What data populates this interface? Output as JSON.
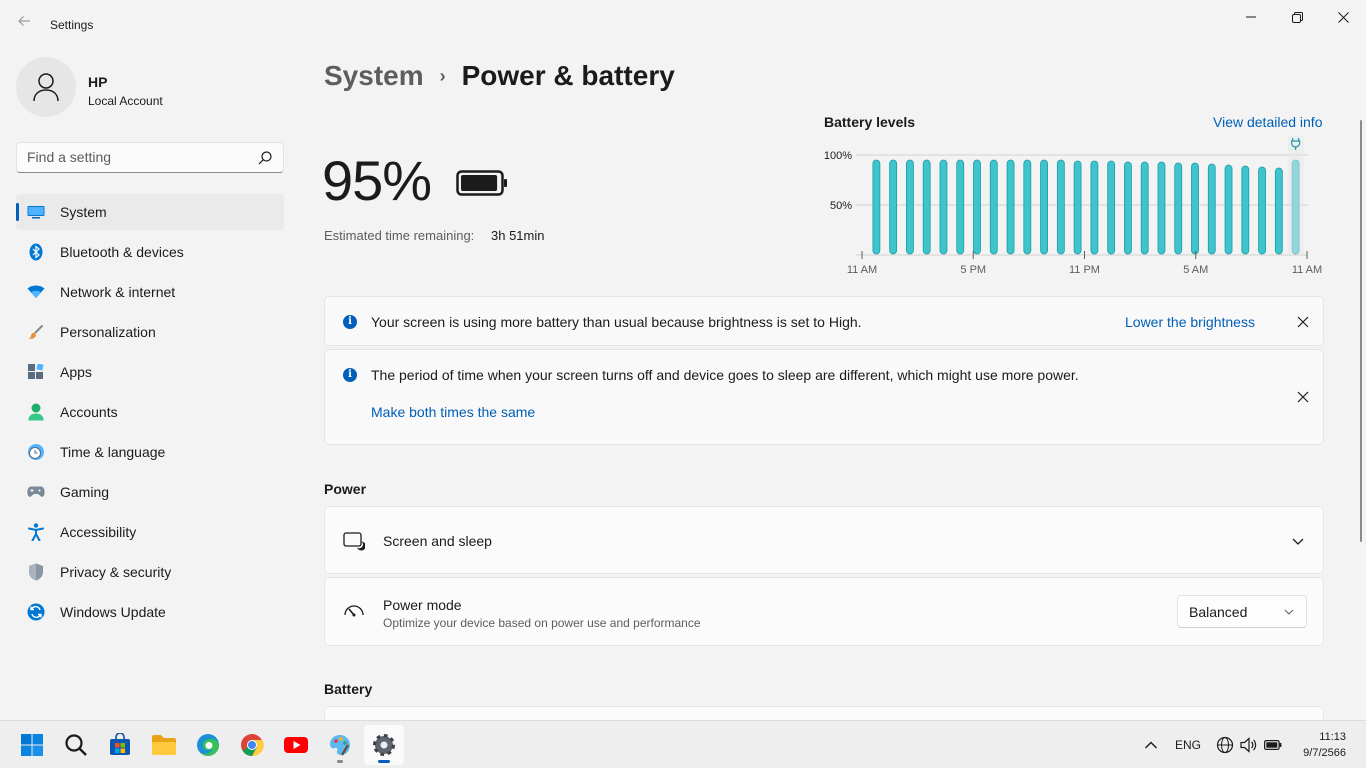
{
  "window": {
    "title": "Settings"
  },
  "profile": {
    "name": "HP",
    "account_type": "Local Account"
  },
  "search": {
    "placeholder": "Find a setting"
  },
  "nav": [
    {
      "label": "System",
      "icon": "monitor-icon",
      "active": true
    },
    {
      "label": "Bluetooth & devices",
      "icon": "bluetooth-icon"
    },
    {
      "label": "Network & internet",
      "icon": "wifi-icon"
    },
    {
      "label": "Personalization",
      "icon": "brush-icon"
    },
    {
      "label": "Apps",
      "icon": "apps-icon"
    },
    {
      "label": "Accounts",
      "icon": "person-icon"
    },
    {
      "label": "Time & language",
      "icon": "clock-globe-icon"
    },
    {
      "label": "Gaming",
      "icon": "gamepad-icon"
    },
    {
      "label": "Accessibility",
      "icon": "accessibility-icon"
    },
    {
      "label": "Privacy & security",
      "icon": "shield-icon"
    },
    {
      "label": "Windows Update",
      "icon": "update-icon"
    }
  ],
  "breadcrumb": {
    "parent": "System",
    "separator": "›",
    "current": "Power & battery"
  },
  "battery": {
    "percent": "95%",
    "estimate_label": "Estimated time remaining:",
    "estimate_value": "3h 51min",
    "level": 0.95
  },
  "battery_chart": {
    "title": "Battery levels",
    "link": "View detailed info",
    "y_ticks": [
      "100%",
      "50%"
    ],
    "x_ticks": [
      "11 AM",
      "5 PM",
      "11 PM",
      "5 AM",
      "11 AM"
    ],
    "bar_color": "#3ec4cc",
    "bar_values": [
      95,
      95,
      95,
      95,
      95,
      95,
      95,
      95,
      95,
      95,
      95,
      95,
      94,
      94,
      94,
      93,
      93,
      93,
      92,
      92,
      91,
      90,
      89,
      88,
      87,
      95
    ],
    "charging_icon": "plug-icon"
  },
  "notices": [
    {
      "text": "Your screen is using more battery than usual because brightness is set to High.",
      "action": "Lower the brightness"
    },
    {
      "text": "The period of time when your screen turns off and device goes to sleep are different, which might use more power.",
      "action": "Make both times the same"
    }
  ],
  "power_section": {
    "title": "Power",
    "screen_sleep": {
      "title": "Screen and sleep",
      "icon": "screen-sleep-icon"
    },
    "power_mode": {
      "title": "Power mode",
      "subtitle": "Optimize your device based on power use and performance",
      "value": "Balanced",
      "icon": "gauge-icon"
    }
  },
  "battery_section": {
    "title": "Battery"
  },
  "taskbar": {
    "apps": [
      "start-icon",
      "search-icon",
      "store-icon",
      "file-explorer-icon",
      "edge-icon",
      "chrome-icon",
      "youtube-icon",
      "paint-icon",
      "settings-icon"
    ],
    "language": "ENG",
    "time": "11:13",
    "date": "9/7/2566"
  },
  "colors": {
    "accent": "#005fb8",
    "chart_bar": "#3ec4cc"
  }
}
